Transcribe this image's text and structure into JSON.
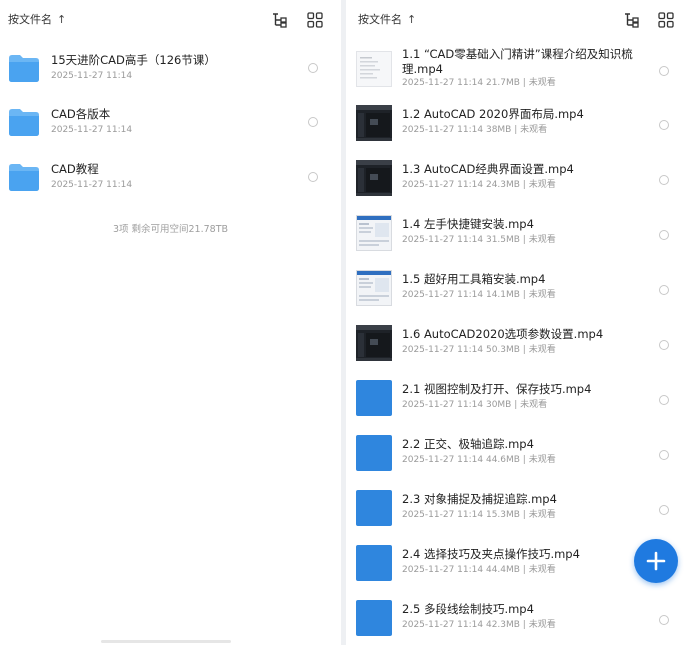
{
  "left": {
    "sort_label": "按文件名",
    "items": [
      {
        "name": "15天进阶CAD高手（126节课）",
        "date": "2025-11-27 11:14"
      },
      {
        "name": "CAD各版本",
        "date": "2025-11-27 11:14"
      },
      {
        "name": "CAD教程",
        "date": "2025-11-27 11:14"
      }
    ],
    "footer": "3项  剩余可用空间21.78TB"
  },
  "right": {
    "sort_label": "按文件名",
    "items": [
      {
        "name": "1.1 “CAD零基础入门精讲”课程介绍及知识梳理.mp4",
        "meta": "2025-11-27 11:14  21.7MB | 未观看",
        "thumb": "light"
      },
      {
        "name": "1.2 AutoCAD 2020界面布局.mp4",
        "meta": "2025-11-27 11:14  38MB | 未观看",
        "thumb": "dark"
      },
      {
        "name": "1.3 AutoCAD经典界面设置.mp4",
        "meta": "2025-11-27 11:14  24.3MB | 未观看",
        "thumb": "dark"
      },
      {
        "name": "1.4 左手快捷键安装.mp4",
        "meta": "2025-11-27 11:14  31.5MB | 未观看",
        "thumb": "screen"
      },
      {
        "name": "1.5 超好用工具箱安装.mp4",
        "meta": "2025-11-27 11:14  14.1MB | 未观看",
        "thumb": "screen"
      },
      {
        "name": "1.6 AutoCAD2020选项参数设置.mp4",
        "meta": "2025-11-27 11:14  50.3MB | 未观看",
        "thumb": "dark"
      },
      {
        "name": "2.1 视图控制及打开、保存技巧.mp4",
        "meta": "2025-11-27 11:14  30MB | 未观看",
        "thumb": "blue"
      },
      {
        "name": "2.2 正交、极轴追踪.mp4",
        "meta": "2025-11-27 11:14  44.6MB | 未观看",
        "thumb": "blue"
      },
      {
        "name": "2.3 对象捕捉及捕捉追踪.mp4",
        "meta": "2025-11-27 11:14  15.3MB | 未观看",
        "thumb": "blue"
      },
      {
        "name": "2.4 选择技巧及夹点操作技巧.mp4",
        "meta": "2025-11-27 11:14  44.4MB | 未观看",
        "thumb": "blue"
      },
      {
        "name": "2.5 多段线绘制技巧.mp4",
        "meta": "2025-11-27 11:14  42.3MB | 未观看",
        "thumb": "blue"
      }
    ]
  },
  "icons": {
    "sort": "arrow-up-icon",
    "tree": "tree-structure-icon",
    "grid": "grid-view-icon",
    "fab": "plus-icon",
    "folder": "folder-icon"
  },
  "colors": {
    "folder": "#4aa3f0",
    "fab": "#1f7ae0",
    "thumb_blue": "#2f86de"
  }
}
